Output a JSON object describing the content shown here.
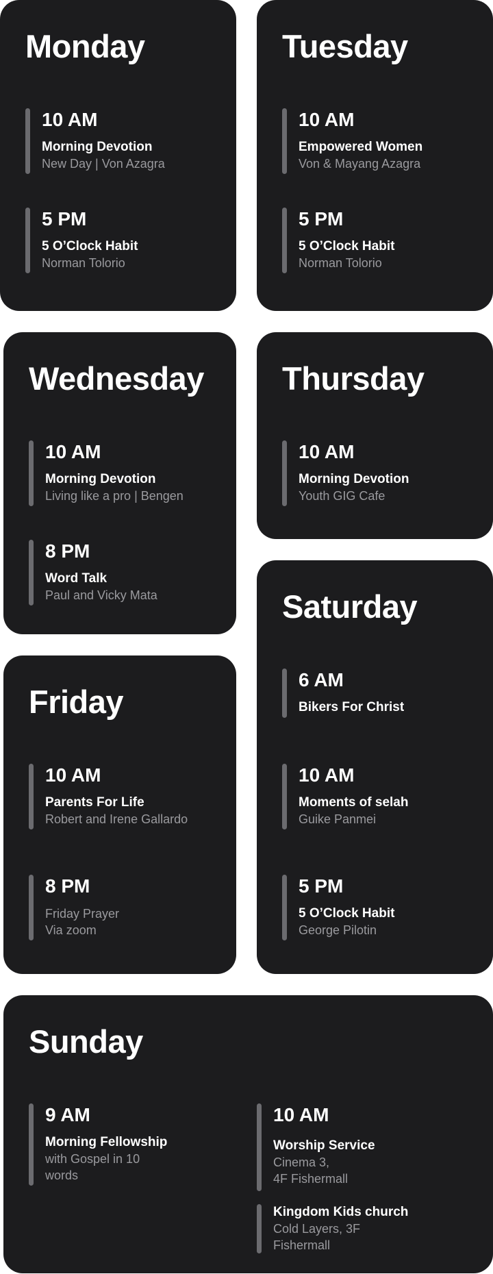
{
  "schedule": {
    "monday": {
      "day": "Monday",
      "events": [
        {
          "time": "10 AM",
          "title": "Morning Devotion",
          "sub": "New Day | Von Azagra"
        },
        {
          "time": "5 PM",
          "title": "5 O’Clock Habit",
          "sub": "Norman Tolorio"
        }
      ]
    },
    "tuesday": {
      "day": "Tuesday",
      "events": [
        {
          "time": "10 AM",
          "title": "Empowered Women",
          "sub": "Von & Mayang Azagra"
        },
        {
          "time": "5 PM",
          "title": "5 O’Clock Habit",
          "sub": "Norman Tolorio"
        }
      ]
    },
    "wednesday": {
      "day": "Wednesday",
      "events": [
        {
          "time": "10 AM",
          "title": "Morning Devotion",
          "sub": "Living like a pro | Bengen"
        },
        {
          "time": "8 PM",
          "title": "Word Talk",
          "sub": "Paul and Vicky Mata"
        }
      ]
    },
    "thursday": {
      "day": "Thursday",
      "events": [
        {
          "time": "10 AM",
          "title": "Morning Devotion",
          "sub": "Youth GIG Cafe"
        }
      ]
    },
    "friday": {
      "day": "Friday",
      "events": [
        {
          "time": "10 AM",
          "title": "Parents For Life",
          "sub": "Robert and Irene Gallardo"
        },
        {
          "time": "8 PM",
          "sub_line1": "Friday  Prayer",
          "sub_line2": "Via zoom"
        }
      ]
    },
    "saturday": {
      "day": "Saturday",
      "events": [
        {
          "time": "6 AM",
          "title": "Bikers For Christ"
        },
        {
          "time": "10 AM",
          "title": "Moments of selah",
          "sub": "Guike Panmei"
        },
        {
          "time": "5 PM",
          "title": "5 O’Clock Habit",
          "sub": "George Pilotin"
        }
      ]
    },
    "sunday": {
      "day": "Sunday",
      "events": [
        {
          "time": "9 AM",
          "title": "Morning Fellowship",
          "sub_line1": "with Gospel in 10",
          "sub_line2": "words"
        },
        {
          "time": "10 AM",
          "title": "Worship Service",
          "sub_line1": "Cinema 3,",
          "sub_line2": "4F Fishermall"
        },
        {
          "title": "Kingdom Kids church",
          "sub_line1": "Cold Layers, 3F",
          "sub_line2": "Fishermall"
        }
      ]
    }
  }
}
